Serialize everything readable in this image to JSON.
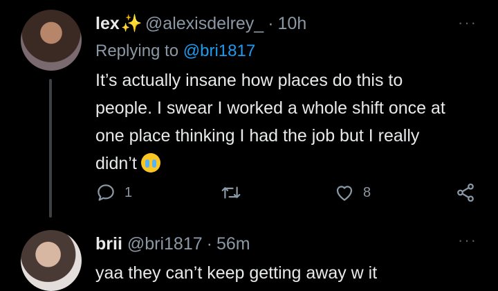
{
  "tweet1": {
    "name": "lex",
    "name_emoji": "✨",
    "handle": "@alexisdelrey_",
    "separator": "·",
    "time": "10h",
    "replying_prefix": "Replying to",
    "replying_handle": "@bri1817",
    "text_lines": [
      "It’s actually insane how places do this to",
      "people. I swear I worked a whole shift once at",
      "one place thinking I had the job but I really",
      "didn’t"
    ],
    "reply_count": "1",
    "like_count": "8",
    "more_label": "···"
  },
  "tweet2": {
    "name": "brii",
    "handle": "@bri1817",
    "separator": "·",
    "time": "56m",
    "text": "yaa they can’t keep getting away w it",
    "more_label": "···"
  }
}
